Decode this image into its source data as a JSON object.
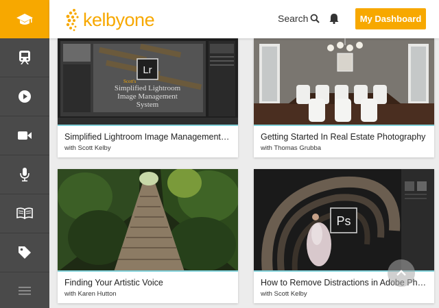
{
  "brand": {
    "name": "kelbyone",
    "accent": "#f7a800",
    "sidebar_bg": "#4a4a4a"
  },
  "sidebar": {
    "items": [
      {
        "icon": "graduation-cap-icon"
      },
      {
        "icon": "train-icon"
      },
      {
        "icon": "play-icon"
      },
      {
        "icon": "video-camera-icon"
      },
      {
        "icon": "microphone-icon"
      },
      {
        "icon": "book-icon"
      },
      {
        "icon": "tag-icon"
      },
      {
        "icon": "menu-icon"
      }
    ]
  },
  "header": {
    "search_label": "Search",
    "dashboard_label": "My Dashboard"
  },
  "cards": [
    {
      "title": "Simplified Lightroom Image Management System",
      "author": "with Scott Kelby",
      "thumb_text": "Scott's Simplified Lightroom Image Management System",
      "badge": "Lr"
    },
    {
      "title": "Getting Started In Real Estate Photography",
      "author": "with Thomas Grubba"
    },
    {
      "title": "Finding Your Artistic Voice",
      "author": "with Karen Hutton"
    },
    {
      "title": "How to Remove Distractions in Adobe Photoshop",
      "author": "with Scott Kelby",
      "badge": "Ps"
    }
  ]
}
